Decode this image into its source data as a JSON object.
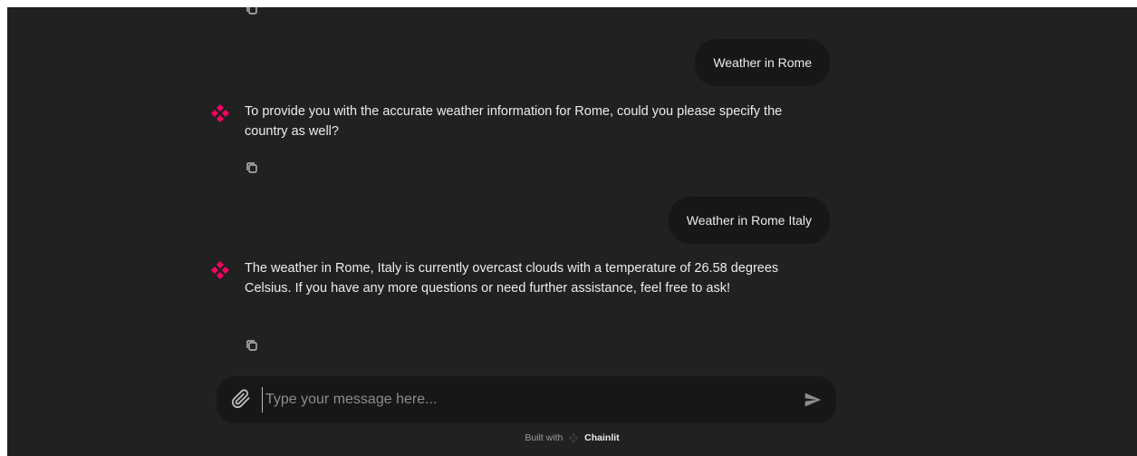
{
  "conversation": [
    {
      "role": "user",
      "text": "Weather in Rome"
    },
    {
      "role": "assistant",
      "text": "To provide you with the accurate weather information for Rome, could you please specify the country as well?"
    },
    {
      "role": "user",
      "text": "Weather in Rome Italy"
    },
    {
      "role": "assistant",
      "text": "The weather in Rome, Italy is currently overcast clouds with a temperature of 26.58 degrees Celsius. If you have any more questions or need further assistance, feel free to ask!"
    }
  ],
  "composer": {
    "placeholder": "Type your message here...",
    "value": ""
  },
  "footer": {
    "built_with": "Built with",
    "brand": "Chainlit"
  },
  "icons": {
    "avatar": "chainlit-logo-icon",
    "copy": "copy-icon",
    "attach": "paperclip-icon",
    "send": "send-icon"
  },
  "colors": {
    "background": "#212121",
    "bubble": "#171717",
    "accent": "#F80061",
    "text": "#ececec"
  }
}
